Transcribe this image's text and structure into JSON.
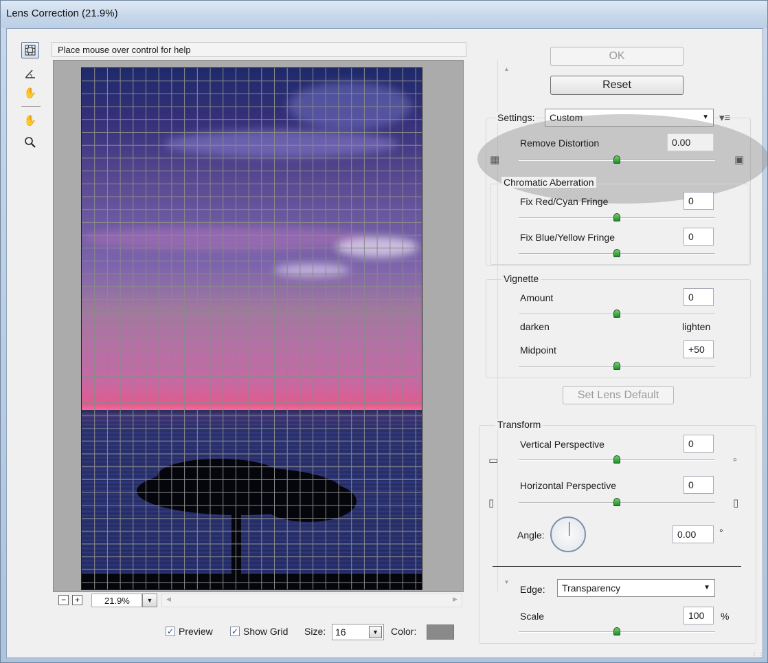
{
  "window": {
    "title": "Lens Correction (21.9%)"
  },
  "help_text": "Place mouse over control for help",
  "tools": [
    "remove-distortion-tool-icon",
    "straighten-tool-icon",
    "move-grid-tool-icon",
    "hand-tool-icon",
    "zoom-tool-icon"
  ],
  "zoom": {
    "value": "21.9%",
    "minus": "−",
    "plus": "+"
  },
  "options": {
    "preview_label": "Preview",
    "preview_checked": true,
    "show_grid_label": "Show Grid",
    "show_grid_checked": true,
    "size_label": "Size:",
    "size_value": "16",
    "color_label": "Color:",
    "grid_color": "#8a8a8a"
  },
  "buttons": {
    "ok": "OK",
    "reset": "Reset",
    "set_lens_default": "Set Lens Default"
  },
  "settings": {
    "label": "Settings:",
    "value": "Custom"
  },
  "remove_distortion": {
    "label": "Remove Distortion",
    "value": "0.00"
  },
  "chromatic_aberration": {
    "title": "Chromatic Aberration",
    "red_cyan_label": "Fix Red/Cyan Fringe",
    "red_cyan_value": "0",
    "blue_yellow_label": "Fix Blue/Yellow Fringe",
    "blue_yellow_value": "0"
  },
  "vignette": {
    "title": "Vignette",
    "amount_label": "Amount",
    "amount_value": "0",
    "darken": "darken",
    "lighten": "lighten",
    "midpoint_label": "Midpoint",
    "midpoint_value": "+50"
  },
  "transform": {
    "title": "Transform",
    "vertical_label": "Vertical Perspective",
    "vertical_value": "0",
    "horizontal_label": "Horizontal Perspective",
    "horizontal_value": "0",
    "angle_label": "Angle:",
    "angle_value": "0.00",
    "angle_unit": "°",
    "edge_label": "Edge:",
    "edge_value": "Transparency",
    "scale_label": "Scale",
    "scale_value": "100",
    "scale_unit": "%"
  }
}
